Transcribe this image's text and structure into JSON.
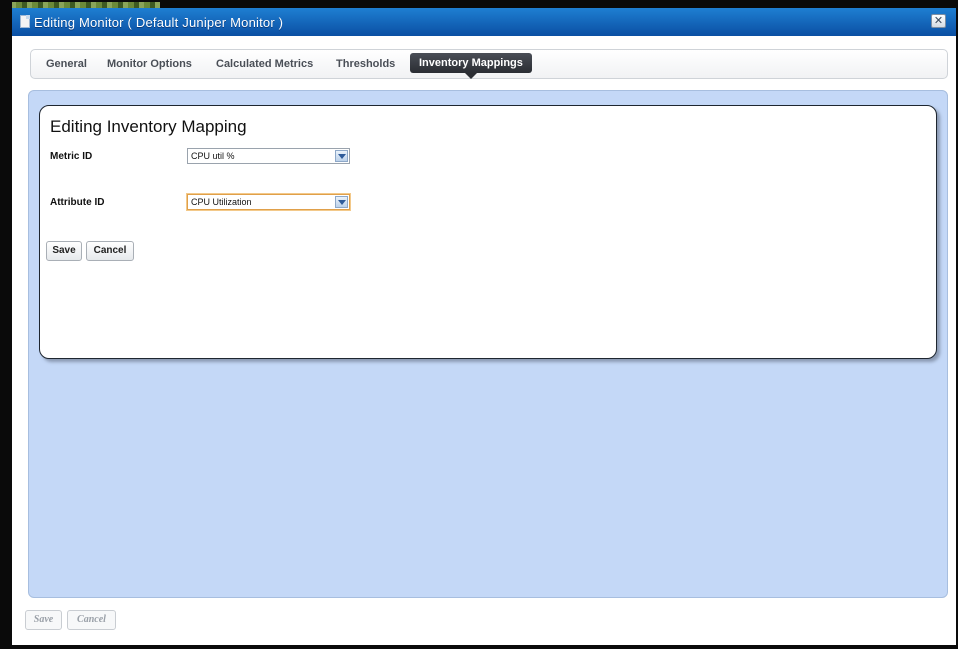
{
  "dialog": {
    "title": "Editing Monitor ( Default Juniper Monitor )",
    "close_glyph": "✕",
    "icons": {
      "title": "document-icon",
      "close": "close-icon",
      "dropdown": "chevron-down-icon"
    }
  },
  "tabs": [
    {
      "label": "General",
      "active": false
    },
    {
      "label": "Monitor Options",
      "active": false
    },
    {
      "label": "Calculated Metrics",
      "active": false
    },
    {
      "label": "Thresholds",
      "active": false
    },
    {
      "label": "Inventory Mappings",
      "active": true
    }
  ],
  "editor": {
    "title": "Editing Inventory Mapping",
    "metric_id": {
      "label": "Metric ID",
      "value": "CPU util %"
    },
    "attribute_id": {
      "label": "Attribute ID",
      "value": "CPU Utilization"
    },
    "save_label": "Save",
    "cancel_label": "Cancel"
  },
  "footer": {
    "save_label": "Save",
    "cancel_label": "Cancel"
  },
  "colors": {
    "titlebar": "#0b4fa3",
    "panel": "#c4d8f7",
    "active_tab": "#2a2d33",
    "focus_border": "#e0a04a"
  }
}
